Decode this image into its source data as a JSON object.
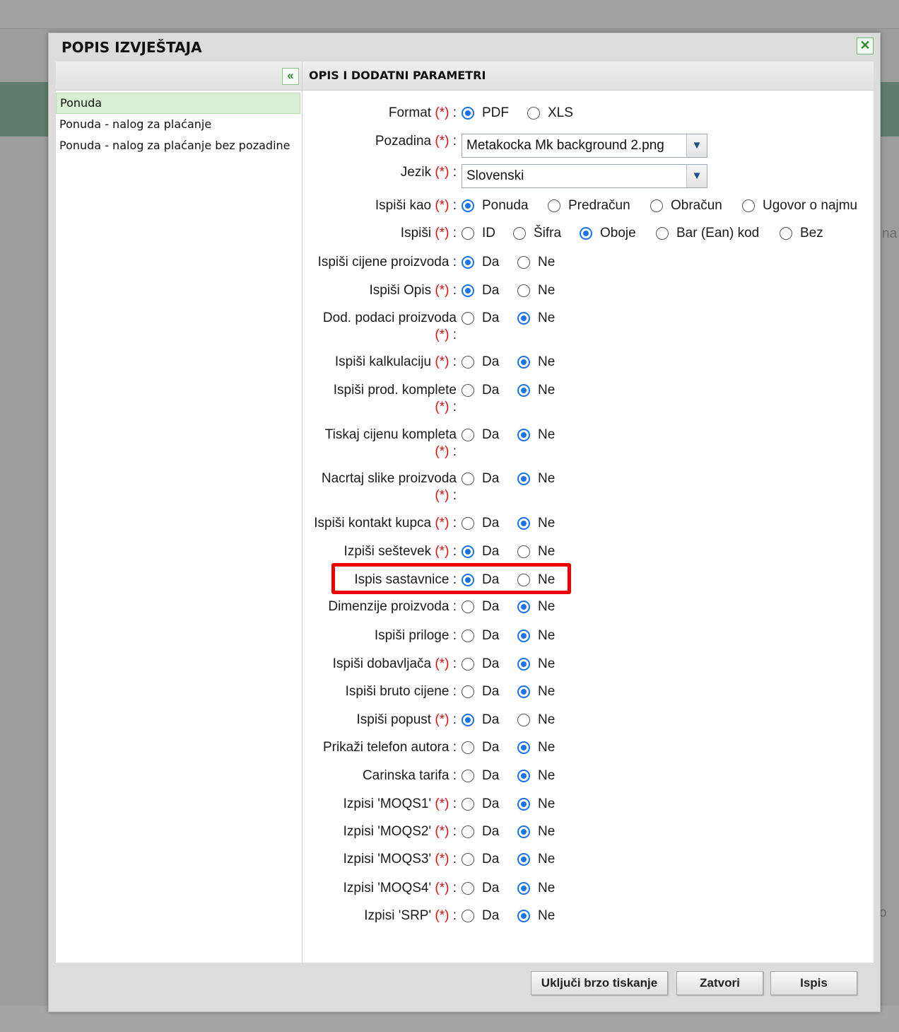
{
  "dialog": {
    "title": "POPIS IZVJEŠTAJA",
    "close_icon": "close-icon",
    "collapse_icon": "double-chevron-left-icon"
  },
  "left": {
    "items": [
      {
        "label": "Ponuda",
        "selected": true
      },
      {
        "label": "Ponuda - nalog za plaćanje",
        "selected": false
      },
      {
        "label": "Ponuda - nalog za plaćanje bez pozadine",
        "selected": false
      }
    ]
  },
  "right": {
    "header": "OPIS I DODATNI PARAMETRI",
    "required_marker": "(*)",
    "format": {
      "label": "Format",
      "options": [
        "PDF",
        "XLS"
      ],
      "selected": "PDF"
    },
    "pozadina": {
      "label": "Pozadina",
      "value": "Metakocka Mk background 2.png"
    },
    "jezik": {
      "label": "Jezik",
      "value": "Slovenski"
    },
    "ispisi_kao": {
      "label": "Ispiši kao",
      "options": [
        "Ponuda",
        "Predračun",
        "Obračun",
        "Ugovor o najmu"
      ],
      "selected": "Ponuda"
    },
    "ispisi": {
      "label": "Ispiši",
      "options": [
        "ID",
        "Šifra",
        "Oboje",
        "Bar (Ean) kod",
        "Bez"
      ],
      "selected": "Oboje"
    },
    "yes": "Da",
    "no": "Ne",
    "yesno_rows": [
      {
        "label": "Ispiši cijene proizvoda",
        "required": false,
        "value": "Da"
      },
      {
        "label": "Ispiši Opis",
        "required": true,
        "value": "Da"
      },
      {
        "label": "Dod. podaci proizvoda",
        "required": true,
        "value": "Ne"
      },
      {
        "label": "Ispiši kalkulaciju",
        "required": true,
        "value": "Ne"
      },
      {
        "label": "Ispiši prod. komplete",
        "required": true,
        "value": "Ne"
      },
      {
        "label": "Tiskaj cijenu kompleta",
        "required": true,
        "value": "Ne"
      },
      {
        "label": "Nacrtaj slike proizvoda",
        "required": true,
        "value": "Ne"
      },
      {
        "label": "Ispiši kontakt kupca",
        "required": true,
        "value": "Ne"
      },
      {
        "label": "Izpiši seštevek",
        "required": true,
        "value": "Da"
      },
      {
        "label": "Ispis sastavnice",
        "required": false,
        "value": "Da"
      },
      {
        "label": "Dimenzije proizvoda",
        "required": false,
        "value": "Ne"
      },
      {
        "label": "Ispiši priloge",
        "required": false,
        "value": "Ne"
      },
      {
        "label": "Ispiši dobavljača",
        "required": true,
        "value": "Ne"
      },
      {
        "label": "Ispiši bruto cijene",
        "required": false,
        "value": "Ne"
      },
      {
        "label": "Ispiši popust",
        "required": true,
        "value": "Da"
      },
      {
        "label": "Prikaži telefon autora",
        "required": false,
        "value": "Ne"
      },
      {
        "label": "Carinska tarifa",
        "required": false,
        "value": "Ne"
      },
      {
        "label": "Izpisi 'MOQS1'",
        "required": true,
        "value": "Ne"
      },
      {
        "label": "Izpisi 'MOQS2'",
        "required": true,
        "value": "Ne"
      },
      {
        "label": "Izpisi 'MOQS3'",
        "required": true,
        "value": "Ne"
      },
      {
        "label": "Izpisi 'MOQS4'",
        "required": true,
        "value": "Ne"
      },
      {
        "label": "Izpisi 'SRP'",
        "required": true,
        "value": "Ne"
      }
    ]
  },
  "buttons": {
    "quick_print": "Uključi brzo tiskanje",
    "close": "Zatvori",
    "print": "Ispis"
  },
  "background": {
    "right_edge_text_1": "na",
    "right_edge_text_2": "o"
  }
}
